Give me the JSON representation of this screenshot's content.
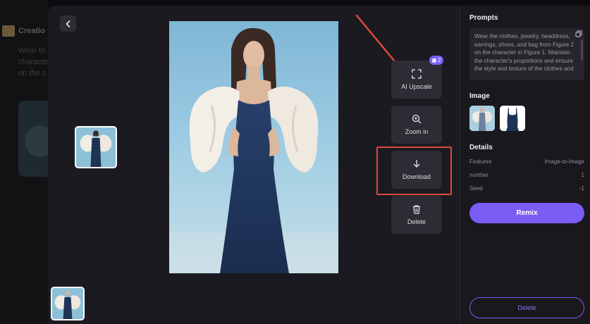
{
  "background": {
    "title": "Creatio",
    "lines": [
      "Wear th",
      "characte",
      "on the c"
    ]
  },
  "actions": {
    "upscale_label": "AI Upscale",
    "upscale_badge": "2",
    "zoom_label": "Zoom in",
    "download_label": "Download",
    "delete_label": "Delete"
  },
  "panel": {
    "prompts_heading": "Prompts",
    "prompt_text": "Wear the clothes, jewelry, headdress, earrings, shoes, and bag from Figure 2 on the character in Figure 1. Maintain the character's proportions and ensure the style and texture of the clothes and",
    "image_heading": "Image",
    "details_heading": "Details",
    "details": [
      {
        "key": "Features",
        "value": "Image-to-Image"
      },
      {
        "key": "number",
        "value": "1"
      },
      {
        "key": "Seed",
        "value": "-1"
      }
    ],
    "remix_label": "Remix",
    "delete_label": "Delete"
  },
  "colors": {
    "accent": "#7b5cf5",
    "highlight": "#e0483d",
    "modal_bg": "#1b1a20"
  },
  "icons": {
    "back": "chevron-left-icon",
    "upscale": "expand-icon",
    "zoom": "zoom-in-icon",
    "download": "download-icon",
    "delete": "trash-icon",
    "copy": "copy-icon"
  }
}
